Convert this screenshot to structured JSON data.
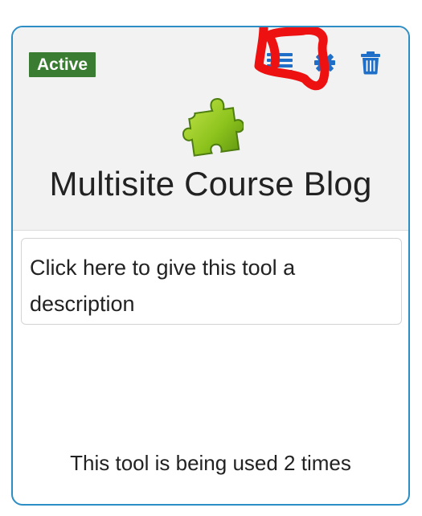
{
  "tool_card": {
    "status_badge": "Active",
    "title": "Multisite Course Blog",
    "description": "Click here to give this tool a description",
    "usage_text": "This tool is being used 2 times",
    "actions": [
      {
        "name": "list",
        "icon": "list-icon"
      },
      {
        "name": "settings",
        "icon": "gear-icon"
      },
      {
        "name": "delete",
        "icon": "trash-icon"
      }
    ],
    "tool_icon": "puzzle-piece-icon"
  },
  "colors": {
    "badge_bg": "#3a7d32",
    "icon_blue": "#1f6fc8",
    "border_blue": "#2d8ec6",
    "header_bg": "#f2f2f2",
    "annotation_red": "#ee1111",
    "puzzle_green": "#8cc21c"
  }
}
